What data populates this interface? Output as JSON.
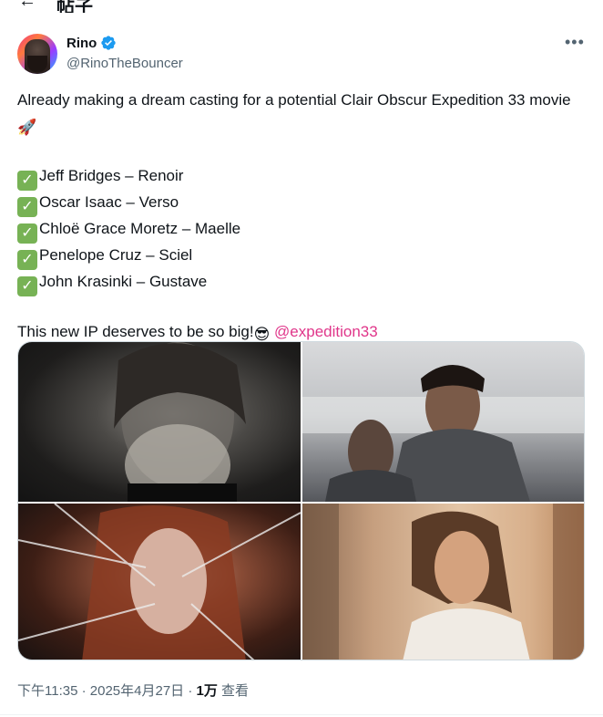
{
  "header": {
    "back_icon": "arrow-left-icon",
    "title": "帖子"
  },
  "author": {
    "display_name": "Rino",
    "handle": "@RinoTheBouncer",
    "verified_icon": "verified-badge-icon",
    "verified_color": "#1d9bf0"
  },
  "more_icon": "more-horizontal-icon",
  "tweet": {
    "intro": "Already making a dream casting for a potential Clair Obscur Expedition 33 movie",
    "intro_emoji": "🚀",
    "cast": [
      {
        "check_icon": "check-mark-button-icon",
        "text": "Jeff Bridges – Renoir"
      },
      {
        "check_icon": "check-mark-button-icon",
        "text": "Oscar Isaac – Verso"
      },
      {
        "check_icon": "check-mark-button-icon",
        "text": "Chloë Grace Moretz – Maelle"
      },
      {
        "check_icon": "check-mark-button-icon",
        "text": "Penelope Cruz – Sciel"
      },
      {
        "check_icon": "check-mark-button-icon",
        "text": "John Krasinki – Gustave"
      }
    ],
    "closing": "This new IP deserves to be so big!",
    "closing_emoji": "😎",
    "mention": "@expedition33",
    "mention_color": "#e0368a"
  },
  "media": [
    {
      "name": "photo-jeff-bridges"
    },
    {
      "name": "photo-oscar-isaac"
    },
    {
      "name": "photo-chloe-grace-moretz"
    },
    {
      "name": "photo-penelope-cruz"
    }
  ],
  "meta": {
    "time": "下午11:35",
    "date": "2025年4月27日",
    "views_count": "1万",
    "views_label": "查看"
  }
}
